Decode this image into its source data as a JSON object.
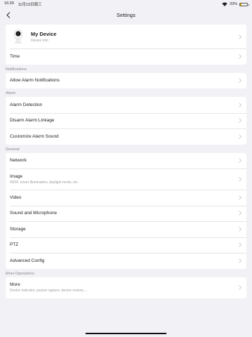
{
  "status_bar": {
    "time": "16:39",
    "date": "11月13日周三",
    "battery_percent": "20%",
    "battery_level": 0.2
  },
  "nav": {
    "title": "Settings"
  },
  "device": {
    "name": "My Device",
    "subtitle": "Device Info"
  },
  "top_items": [
    {
      "label": "Time"
    }
  ],
  "notifications": {
    "header": "Notifications",
    "items": [
      {
        "label": "Allow Alarm Notifications"
      }
    ]
  },
  "alarm": {
    "header": "Alarm",
    "items": [
      {
        "label": "Alarm Detection"
      },
      {
        "label": "Disarm Alarm Linkage"
      },
      {
        "label": "Customize Alarm Sound"
      }
    ]
  },
  "general": {
    "header": "General",
    "items": [
      {
        "label": "Network"
      },
      {
        "label": "Image",
        "sub": "WDR, smart illumination, daylight mode, etc."
      },
      {
        "label": "Video"
      },
      {
        "label": "Sound and Microphone"
      },
      {
        "label": "Storage"
      },
      {
        "label": "PTZ"
      },
      {
        "label": "Advanced Config"
      }
    ]
  },
  "more_operations": {
    "header": "More Operations",
    "items": [
      {
        "label": "More",
        "sub": "Device indicator, packet capture, device restore,..."
      }
    ]
  },
  "colors": {
    "background": "#f2f2f6",
    "card": "#ffffff",
    "text": "#222222",
    "secondary_text": "#8a8a8f",
    "chevron": "#c4c4c7"
  }
}
